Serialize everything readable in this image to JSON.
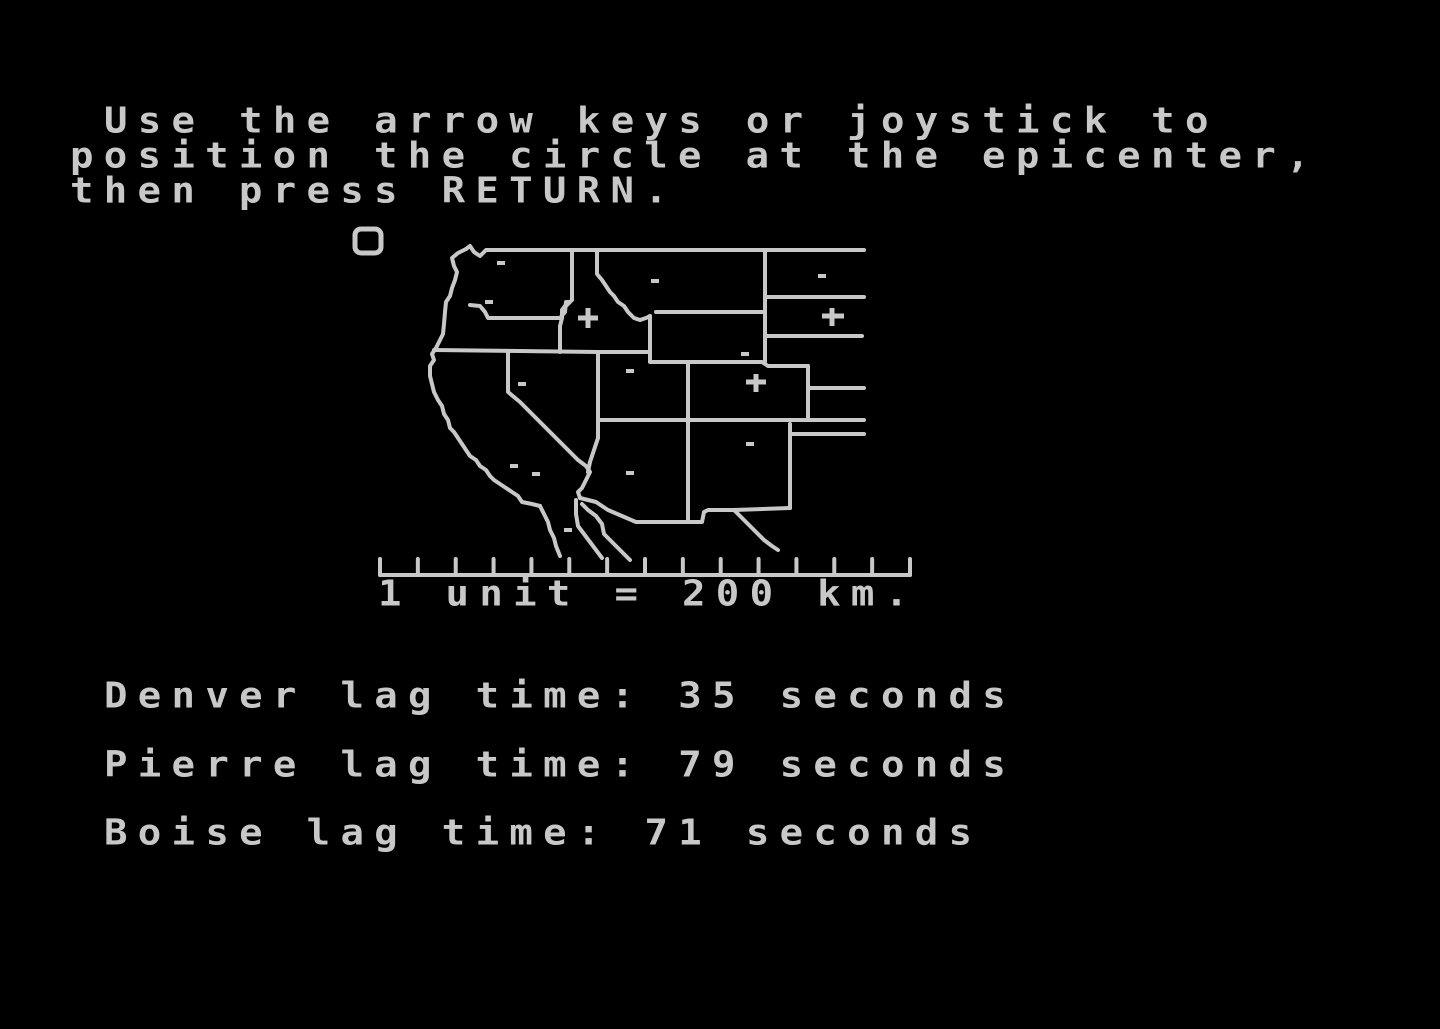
{
  "screen": {
    "background_color": "#000000",
    "foreground_color": "#c8c8c8"
  },
  "instructions": {
    "line1": "Use the arrow keys or joystick to",
    "line2": "position the circle at the epicenter,",
    "line3": "then press RETURN."
  },
  "map": {
    "region": "Western United States",
    "scale_label": "1 unit = 200 km.",
    "scale_units": 14,
    "stations": [
      {
        "name": "Boise",
        "marker": "cross"
      },
      {
        "name": "Pierre",
        "marker": "cross"
      },
      {
        "name": "Denver",
        "marker": "cross"
      }
    ],
    "cursor": {
      "shape": "circle",
      "label": "epicenter-cursor"
    }
  },
  "lag_times": [
    {
      "city": "Denver",
      "text": "Denver lag time: 35 seconds",
      "seconds": 35
    },
    {
      "city": "Pierre",
      "text": "Pierre lag time: 79 seconds",
      "seconds": 79
    },
    {
      "city": "Boise",
      "text": "Boise lag time: 71 seconds",
      "seconds": 71
    }
  ]
}
